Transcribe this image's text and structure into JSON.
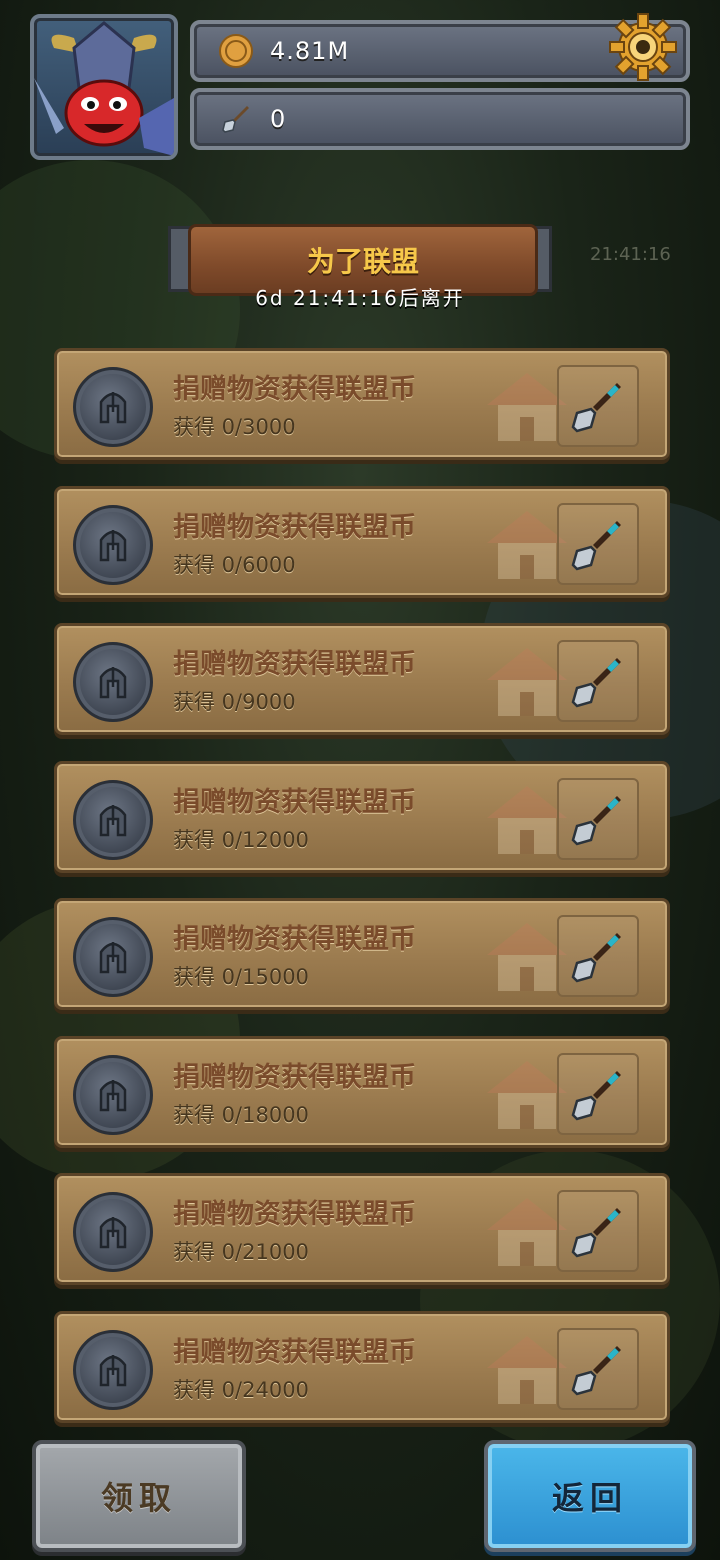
{
  "hud": {
    "coins": "4.81M",
    "shovels": "0"
  },
  "event": {
    "title": "为了联盟",
    "countdown": "6d 21:41:16后离开",
    "side_timer": "21:41:16"
  },
  "tasks": [
    {
      "title": "捐赠物资获得联盟币",
      "progress": "获得 0/3000"
    },
    {
      "title": "捐赠物资获得联盟币",
      "progress": "获得 0/6000"
    },
    {
      "title": "捐赠物资获得联盟币",
      "progress": "获得 0/9000"
    },
    {
      "title": "捐赠物资获得联盟币",
      "progress": "获得 0/12000"
    },
    {
      "title": "捐赠物资获得联盟币",
      "progress": "获得 0/15000"
    },
    {
      "title": "捐赠物资获得联盟币",
      "progress": "获得 0/18000"
    },
    {
      "title": "捐赠物资获得联盟币",
      "progress": "获得 0/21000"
    },
    {
      "title": "捐赠物资获得联盟币",
      "progress": "获得 0/24000"
    }
  ],
  "buttons": {
    "claim": "领取",
    "back": "返回"
  },
  "colors": {
    "title_gold": "#f6c84a",
    "row_parchment": "#9b7b4f",
    "back_blue": "#2c8fd0"
  },
  "icons": {
    "coin": "coin-icon",
    "shovel": "shovel-icon",
    "settings": "gear-icon",
    "alliance": "helmet-coin-icon",
    "house": "house-icon"
  }
}
